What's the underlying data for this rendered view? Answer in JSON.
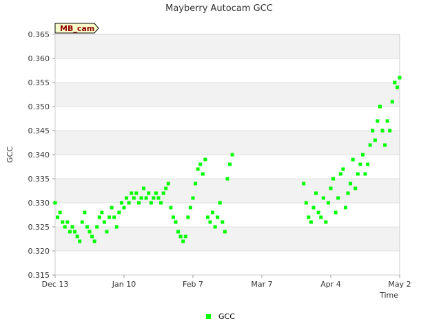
{
  "chart_data": {
    "type": "scatter",
    "title": "Mayberry Autocam GCC",
    "xlabel": "Time",
    "ylabel": "GCC",
    "tag": "MB_cam",
    "x_ticks": [
      "Dec 13",
      "Jan 10",
      "Feb 7",
      "Mar 7",
      "Apr 4",
      "May 2"
    ],
    "y_ticks": [
      "0.315",
      "0.320",
      "0.325",
      "0.330",
      "0.335",
      "0.340",
      "0.345",
      "0.350",
      "0.355",
      "0.360",
      "0.365"
    ],
    "xlim": [
      "2020-12-13",
      "2021-05-02"
    ],
    "ylim": [
      0.315,
      0.365
    ],
    "grid": true,
    "legend_position": "bottom",
    "colors": {
      "series": "#00ff00",
      "band": "#f2f2f2",
      "tag_bg": "#ffffcc"
    },
    "series": [
      {
        "name": "GCC",
        "points": [
          [
            "2020-12-13",
            0.33
          ],
          [
            "2020-12-14",
            0.327
          ],
          [
            "2020-12-15",
            0.328
          ],
          [
            "2020-12-16",
            0.326
          ],
          [
            "2020-12-17",
            0.325
          ],
          [
            "2020-12-18",
            0.326
          ],
          [
            "2020-12-19",
            0.324
          ],
          [
            "2020-12-20",
            0.325
          ],
          [
            "2020-12-21",
            0.324
          ],
          [
            "2020-12-22",
            0.323
          ],
          [
            "2020-12-23",
            0.322
          ],
          [
            "2020-12-24",
            0.326
          ],
          [
            "2020-12-25",
            0.328
          ],
          [
            "2020-12-26",
            0.325
          ],
          [
            "2020-12-27",
            0.324
          ],
          [
            "2020-12-28",
            0.323
          ],
          [
            "2020-12-29",
            0.322
          ],
          [
            "2020-12-30",
            0.325
          ],
          [
            "2020-12-31",
            0.327
          ],
          [
            "2021-01-01",
            0.328
          ],
          [
            "2021-01-02",
            0.326
          ],
          [
            "2021-01-03",
            0.324
          ],
          [
            "2021-01-04",
            0.327
          ],
          [
            "2021-01-05",
            0.329
          ],
          [
            "2021-01-06",
            0.327
          ],
          [
            "2021-01-07",
            0.325
          ],
          [
            "2021-01-08",
            0.328
          ],
          [
            "2021-01-09",
            0.33
          ],
          [
            "2021-01-10",
            0.329
          ],
          [
            "2021-01-11",
            0.331
          ],
          [
            "2021-01-12",
            0.33
          ],
          [
            "2021-01-13",
            0.332
          ],
          [
            "2021-01-14",
            0.331
          ],
          [
            "2021-01-15",
            0.332
          ],
          [
            "2021-01-16",
            0.33
          ],
          [
            "2021-01-17",
            0.331
          ],
          [
            "2021-01-18",
            0.333
          ],
          [
            "2021-01-19",
            0.331
          ],
          [
            "2021-01-20",
            0.332
          ],
          [
            "2021-01-21",
            0.33
          ],
          [
            "2021-01-22",
            0.331
          ],
          [
            "2021-01-23",
            0.332
          ],
          [
            "2021-01-24",
            0.331
          ],
          [
            "2021-01-25",
            0.33
          ],
          [
            "2021-01-26",
            0.332
          ],
          [
            "2021-01-27",
            0.333
          ],
          [
            "2021-01-28",
            0.334
          ],
          [
            "2021-01-29",
            0.329
          ],
          [
            "2021-01-30",
            0.327
          ],
          [
            "2021-01-31",
            0.326
          ],
          [
            "2021-02-01",
            0.324
          ],
          [
            "2021-02-02",
            0.323
          ],
          [
            "2021-02-03",
            0.322
          ],
          [
            "2021-02-04",
            0.323
          ],
          [
            "2021-02-05",
            0.327
          ],
          [
            "2021-02-06",
            0.329
          ],
          [
            "2021-02-07",
            0.331
          ],
          [
            "2021-02-08",
            0.334
          ],
          [
            "2021-02-09",
            0.337
          ],
          [
            "2021-02-10",
            0.338
          ],
          [
            "2021-02-11",
            0.336
          ],
          [
            "2021-02-12",
            0.339
          ],
          [
            "2021-02-13",
            0.327
          ],
          [
            "2021-02-14",
            0.326
          ],
          [
            "2021-02-15",
            0.328
          ],
          [
            "2021-02-16",
            0.325
          ],
          [
            "2021-02-17",
            0.327
          ],
          [
            "2021-02-18",
            0.33
          ],
          [
            "2021-02-19",
            0.326
          ],
          [
            "2021-02-20",
            0.324
          ],
          [
            "2021-02-21",
            0.335
          ],
          [
            "2021-02-22",
            0.338
          ],
          [
            "2021-02-23",
            0.34
          ],
          [
            "2021-03-24",
            0.334
          ],
          [
            "2021-03-25",
            0.33
          ],
          [
            "2021-03-26",
            0.327
          ],
          [
            "2021-03-27",
            0.326
          ],
          [
            "2021-03-28",
            0.329
          ],
          [
            "2021-03-29",
            0.332
          ],
          [
            "2021-03-30",
            0.328
          ],
          [
            "2021-03-31",
            0.327
          ],
          [
            "2021-04-01",
            0.331
          ],
          [
            "2021-04-02",
            0.326
          ],
          [
            "2021-04-03",
            0.33
          ],
          [
            "2021-04-04",
            0.333
          ],
          [
            "2021-04-05",
            0.335
          ],
          [
            "2021-04-06",
            0.328
          ],
          [
            "2021-04-07",
            0.331
          ],
          [
            "2021-04-08",
            0.336
          ],
          [
            "2021-04-09",
            0.337
          ],
          [
            "2021-04-10",
            0.329
          ],
          [
            "2021-04-11",
            0.332
          ],
          [
            "2021-04-12",
            0.334
          ],
          [
            "2021-04-13",
            0.339
          ],
          [
            "2021-04-14",
            0.333
          ],
          [
            "2021-04-15",
            0.336
          ],
          [
            "2021-04-16",
            0.338
          ],
          [
            "2021-04-17",
            0.34
          ],
          [
            "2021-04-18",
            0.336
          ],
          [
            "2021-04-19",
            0.338
          ],
          [
            "2021-04-20",
            0.342
          ],
          [
            "2021-04-21",
            0.345
          ],
          [
            "2021-04-22",
            0.343
          ],
          [
            "2021-04-23",
            0.347
          ],
          [
            "2021-04-24",
            0.35
          ],
          [
            "2021-04-25",
            0.345
          ],
          [
            "2021-04-26",
            0.342
          ],
          [
            "2021-04-27",
            0.347
          ],
          [
            "2021-04-28",
            0.345
          ],
          [
            "2021-04-29",
            0.351
          ],
          [
            "2021-04-30",
            0.355
          ],
          [
            "2021-05-01",
            0.354
          ],
          [
            "2021-05-02",
            0.356
          ]
        ]
      }
    ]
  }
}
